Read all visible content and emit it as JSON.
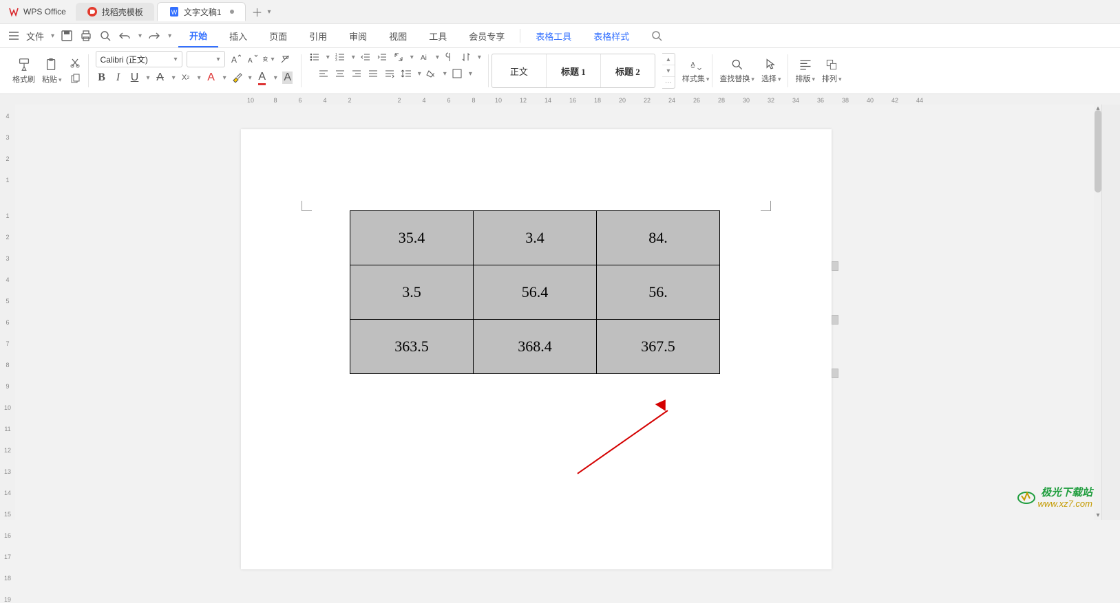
{
  "app": {
    "name": "WPS Office"
  },
  "tabs": {
    "template": "找稻壳模板",
    "doc": "文字文稿1"
  },
  "menu": {
    "file": "文件",
    "items": [
      "开始",
      "插入",
      "页面",
      "引用",
      "审阅",
      "视图",
      "工具",
      "会员专享"
    ],
    "active_index": 0,
    "special": [
      "表格工具",
      "表格样式"
    ]
  },
  "ribbon": {
    "format_painter": "格式刷",
    "paste": "粘贴",
    "font_name": "Calibri (正文)",
    "font_size": "",
    "styles": {
      "normal": "正文",
      "heading1": "标题 1",
      "heading2": "标题 2"
    },
    "style_set": "样式集",
    "find_replace": "查找替换",
    "select": "选择",
    "layout": "排版",
    "arrange": "排列"
  },
  "ruler_h": [
    "10",
    "8",
    "6",
    "4",
    "2",
    "",
    "2",
    "4",
    "6",
    "8",
    "10",
    "12",
    "14",
    "16",
    "18",
    "20",
    "22",
    "24",
    "26",
    "28",
    "30",
    "32",
    "34",
    "36",
    "38",
    "40",
    "42",
    "44"
  ],
  "ruler_v": [
    "4",
    "3",
    "2",
    "1",
    "",
    "1",
    "2",
    "3",
    "4",
    "5",
    "6",
    "7",
    "8",
    "9",
    "10",
    "11",
    "12",
    "13",
    "14",
    "15",
    "16",
    "17",
    "18",
    "19"
  ],
  "table": [
    [
      "35.4",
      "3.4",
      "84."
    ],
    [
      "3.5",
      "56.4",
      "56."
    ],
    [
      "363.5",
      "368.4",
      "367.5"
    ]
  ],
  "watermark": {
    "cn": "极光下载站",
    "url": "www.xz7.com"
  }
}
